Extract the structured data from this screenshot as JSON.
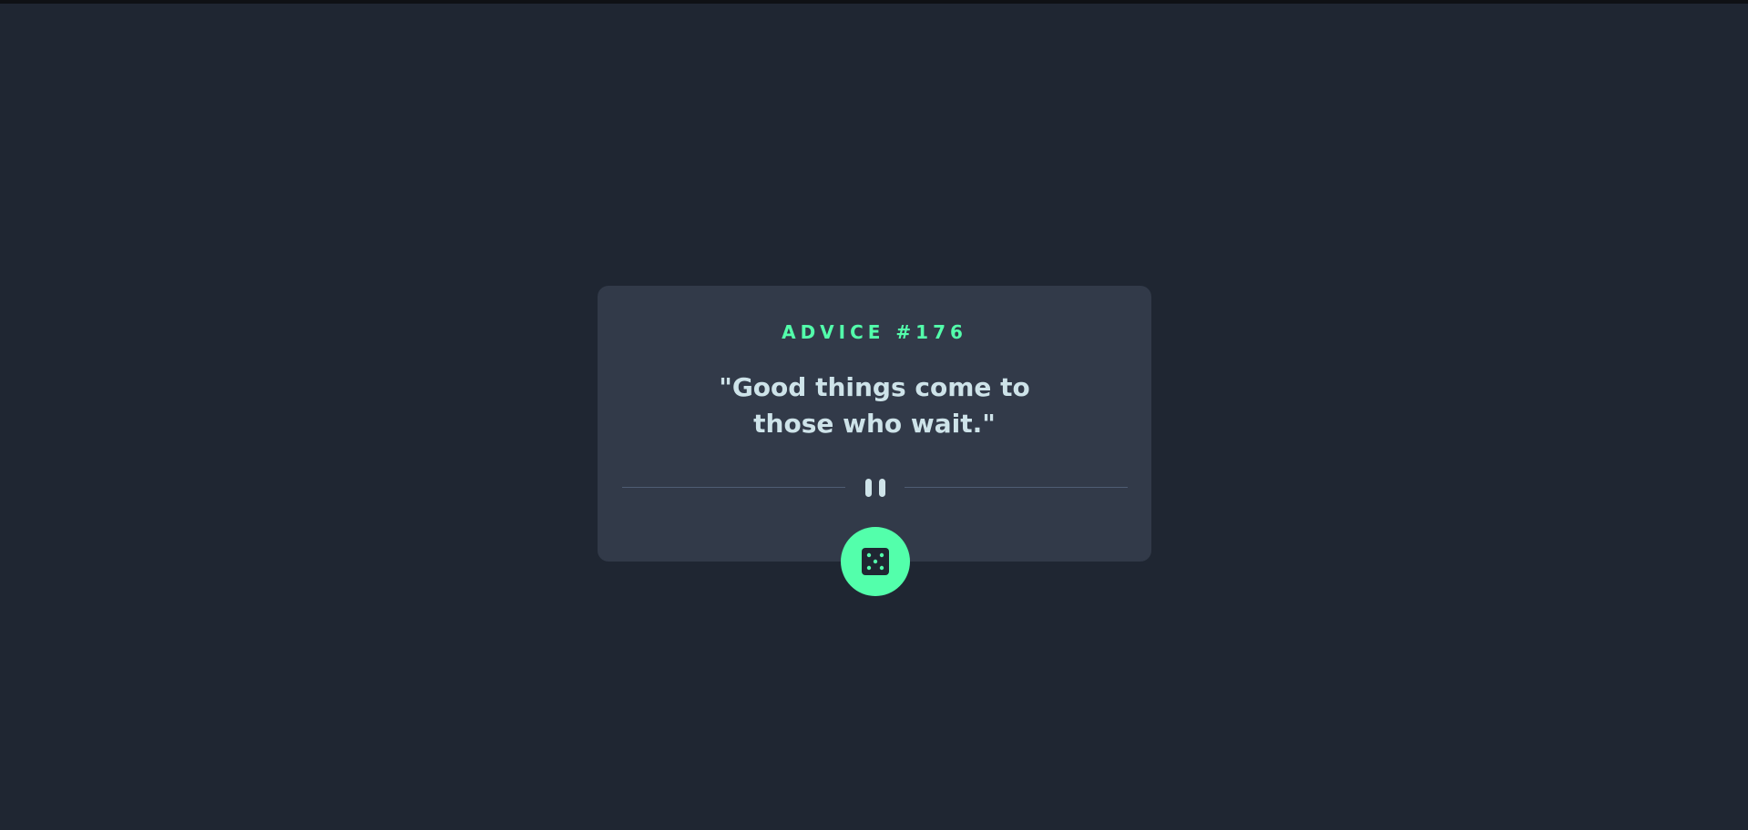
{
  "card": {
    "advice_label": "ADVICE #176",
    "quote": "\"Good things come to those who wait.\""
  },
  "divider": {
    "icon": "pause-icon"
  },
  "button": {
    "icon": "dice-icon",
    "aria_label": "Generate new advice"
  },
  "colors": {
    "background": "#1f2632",
    "card": "#323a49",
    "accent": "#53ffab",
    "text": "#cee3e9",
    "divider": "#4f5d74"
  }
}
